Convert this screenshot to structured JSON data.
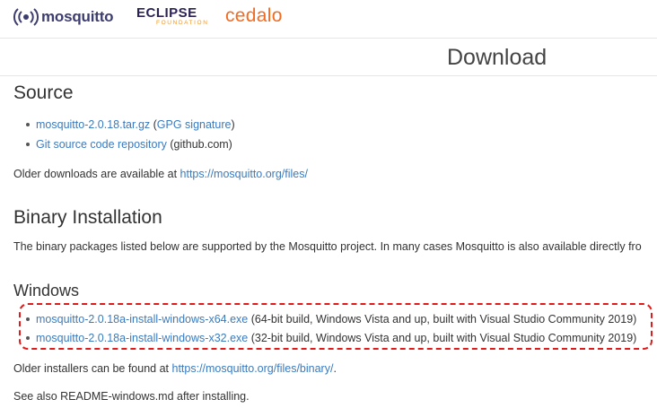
{
  "header": {
    "mosquitto_logo": "mosquitto",
    "eclipse_logo": "ECLIPSE",
    "eclipse_sub": "FOUNDATION",
    "cedalo_logo": "cedalo"
  },
  "page_title": "Download",
  "source": {
    "heading": "Source",
    "items": [
      {
        "link": "mosquitto-2.0.18.tar.gz",
        "pre": " (",
        "link2": "GPG signature",
        "post": ")"
      },
      {
        "link": "Git source code repository",
        "suffix": " (github.com)"
      }
    ],
    "older_text": "Older downloads are available at ",
    "older_link": "https://mosquitto.org/files/"
  },
  "binary": {
    "heading": "Binary Installation",
    "description": "The binary packages listed below are supported by the Mosquitto project. In many cases Mosquitto is also available directly fro"
  },
  "windows": {
    "heading": "Windows",
    "items": [
      {
        "link": "mosquitto-2.0.18a-install-windows-x64.exe",
        "suffix": " (64-bit build, Windows Vista and up, built with Visual Studio Community 2019)"
      },
      {
        "link": "mosquitto-2.0.18a-install-windows-x32.exe",
        "suffix": " (32-bit build, Windows Vista and up, built with Visual Studio Community 2019)"
      }
    ],
    "older_text": "Older installers can be found at ",
    "older_link": "https://mosquitto.org/files/binary/",
    "older_suffix": ".",
    "see_also": "See also README-windows.md after installing."
  },
  "colors": {
    "link": "#3a7bbf",
    "highlight": "#e01b1b",
    "cedalo": "#f26b21",
    "eclipse_orange": "#f7941e"
  },
  "icons": [
    "mosquitto-wave-icon"
  ]
}
